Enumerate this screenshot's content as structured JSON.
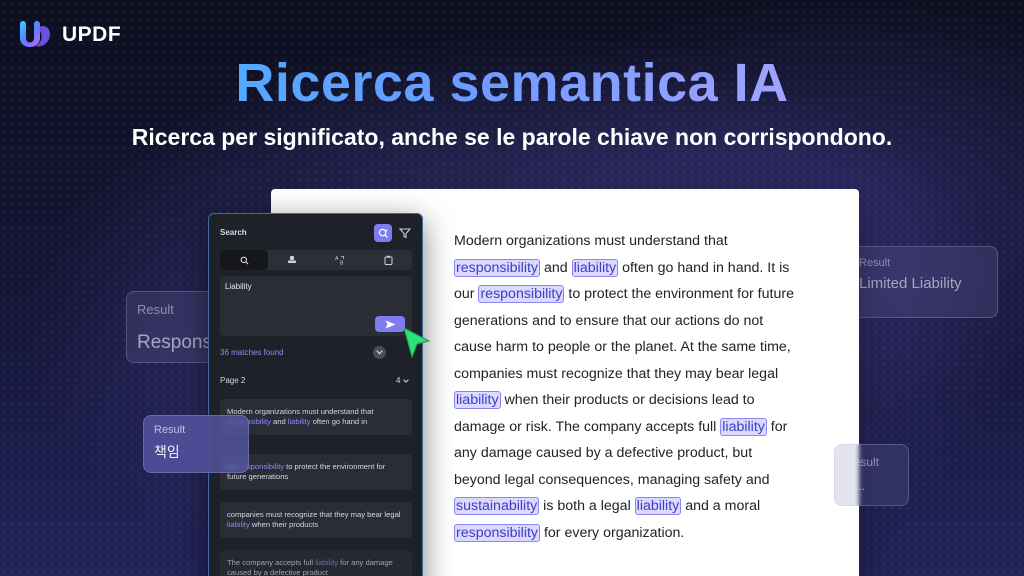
{
  "brand": {
    "name": "UPDF"
  },
  "headline": "Ricerca semantica IA",
  "subtitle": "Ricerca per significato, anche se le parole chiave non corrispondono.",
  "document": {
    "lines": [
      [
        {
          "t": "Modern organizations must understand that"
        }
      ],
      [
        {
          "t": "responsibility",
          "hl": true
        },
        {
          "t": " and "
        },
        {
          "t": "liability",
          "hl": true
        },
        {
          "t": " often go hand in hand. It is"
        }
      ],
      [
        {
          "t": "our "
        },
        {
          "t": "responsibility",
          "hl": true
        },
        {
          "t": " to protect the environment for future"
        }
      ],
      [
        {
          "t": "generations and to ensure that our actions do not"
        }
      ],
      [
        {
          "t": "cause harm to people or the planet. At the same time,"
        }
      ],
      [
        {
          "t": "companies must recognize that they may bear legal"
        }
      ],
      [
        {
          "t": "liability",
          "hl": true
        },
        {
          "t": " when their products or decisions lead to"
        }
      ],
      [
        {
          "t": "damage or risk. The company accepts full "
        },
        {
          "t": "liability",
          "hl": true
        },
        {
          "t": " for"
        }
      ],
      [
        {
          "t": "any damage caused by a defective product, but"
        }
      ],
      [
        {
          "t": "beyond legal consequences, managing safety and"
        }
      ],
      [
        {
          "t": "sustainability",
          "hl": true
        },
        {
          "t": " is both a legal "
        },
        {
          "t": "liability",
          "hl": true
        },
        {
          "t": " and a moral"
        }
      ],
      [
        {
          "t": "responsibility",
          "hl": true
        },
        {
          "t": " for every organization."
        }
      ]
    ]
  },
  "search_panel": {
    "title": "Search",
    "query": "Liability",
    "matches": "36 matches found",
    "page_label": "Page 2",
    "page_count": "4",
    "results": [
      {
        "parts": [
          {
            "t": "Modern organizations must understand that "
          },
          {
            "t": "responsibility",
            "m": true
          },
          {
            "t": " and "
          },
          {
            "t": "liability",
            "m": true
          },
          {
            "t": " often go hand in"
          }
        ]
      },
      {
        "parts": [
          {
            "t": "our "
          },
          {
            "t": "responsibility",
            "m": true
          },
          {
            "t": " to protect the environment for future generations"
          }
        ]
      },
      {
        "parts": [
          {
            "t": "companies must recognize that they may bear legal "
          },
          {
            "t": "liability",
            "m": true
          },
          {
            "t": " when their products"
          }
        ]
      },
      {
        "parts": [
          {
            "t": "The company accepts full "
          },
          {
            "t": "liability",
            "m": true
          },
          {
            "t": " for any damage caused by a defective product"
          }
        ]
      }
    ]
  },
  "result_cards": [
    {
      "label": "Result",
      "value": "Respons"
    },
    {
      "label": "Result",
      "value": "책임"
    },
    {
      "label": "Result",
      "value": "Limited Liability"
    },
    {
      "label": "Result",
      "value": "......"
    }
  ],
  "colors": {
    "accent": "#7f7cf2",
    "highlight_bg": "#dcd9ff",
    "highlight_border": "#8d86f2",
    "cursor": "#2ee27a"
  }
}
